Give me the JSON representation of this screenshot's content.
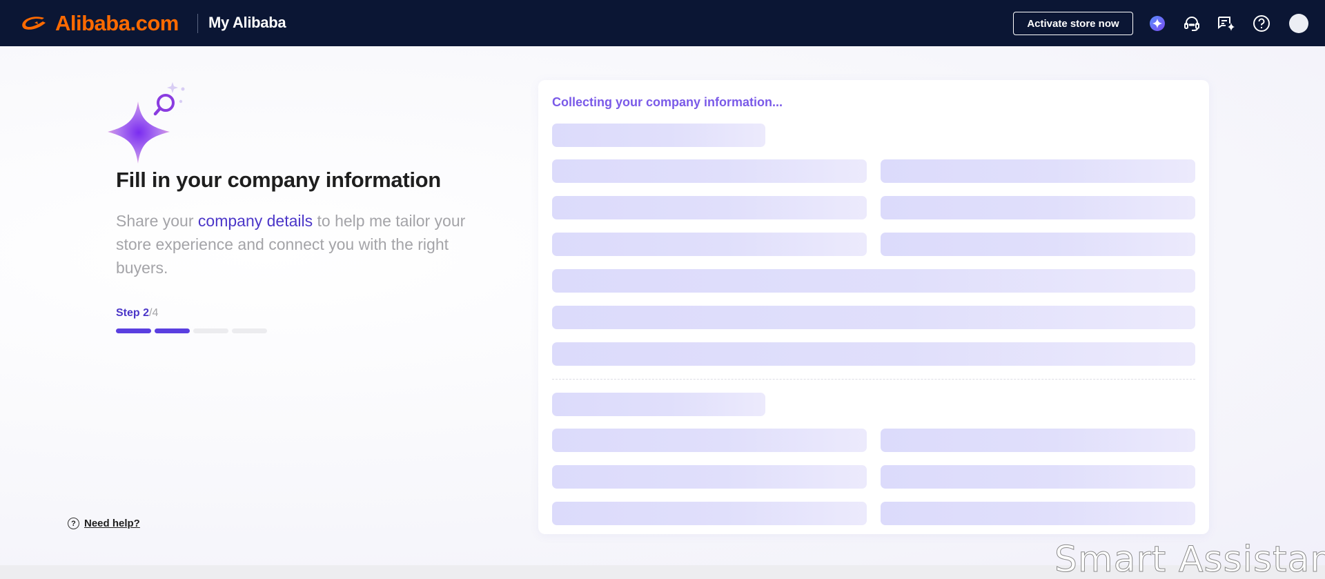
{
  "header": {
    "brand": "Alibaba.com",
    "section": "My Alibaba",
    "activate_label": "Activate store now"
  },
  "intro": {
    "heading": "Fill in your company information",
    "subtext_pre": "Share your ",
    "subtext_link": "company details",
    "subtext_post": " to help me tailor your store experience and connect you with the right buyers."
  },
  "progress": {
    "step_label": "Step ",
    "current": "2",
    "total": "/4",
    "steps_done": 2,
    "steps_total": 4
  },
  "help": {
    "label": "Need help?"
  },
  "card": {
    "title": "Collecting your company information..."
  },
  "watermark": "Smart Assistant",
  "colors": {
    "header_bg": "#0b1634",
    "brand_orange": "#ff6a00",
    "accent_purple": "#5a3fe0",
    "card_title": "#7a5ae8"
  },
  "icons": [
    "ai-assistant-icon",
    "headset-icon",
    "messages-ai-icon",
    "help-icon",
    "avatar"
  ]
}
